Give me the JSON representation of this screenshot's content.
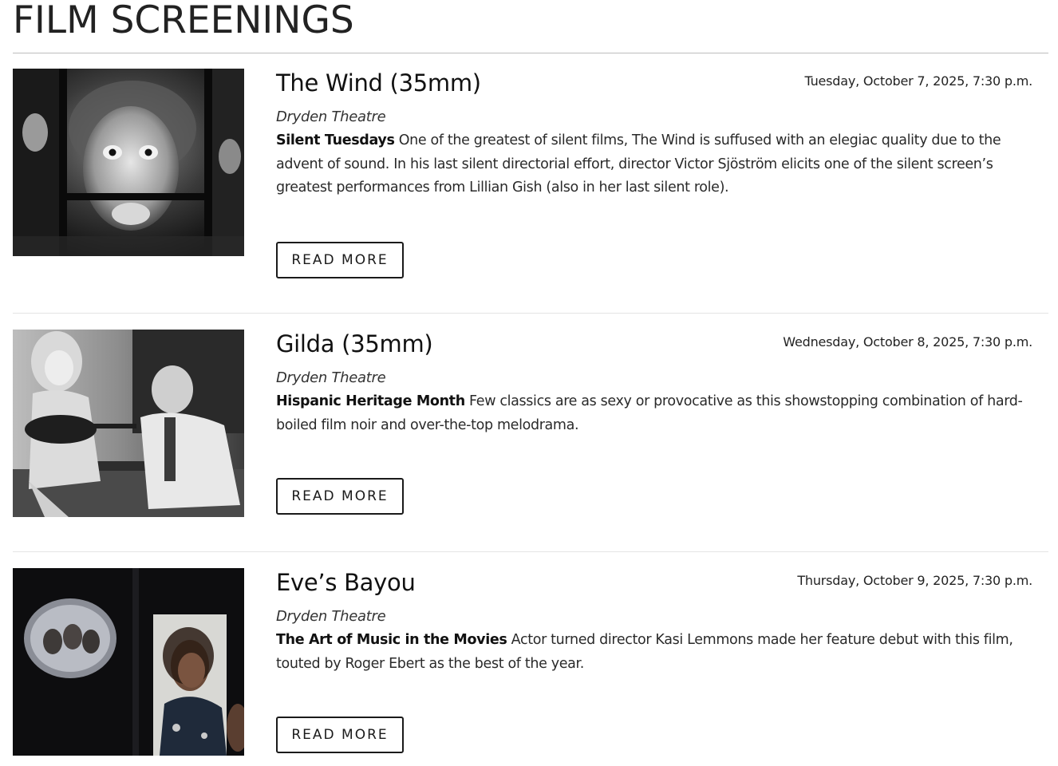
{
  "page": {
    "title": "FILM SCREENINGS"
  },
  "events": [
    {
      "title": "The Wind (35mm)",
      "date": "Tuesday, October 7, 2025, 7:30 p.m.",
      "venue": "Dryden Theatre",
      "series": "Silent Tuesdays",
      "description": "One of the greatest of silent films, The Wind is suffused with an elegiac quality due to the advent of sound. In his last silent directorial effort, director Victor Sjöström elicits one of the silent screen’s greatest performances from Lillian Gish (also in her last silent role).",
      "button": "READ MORE"
    },
    {
      "title": "Gilda (35mm)",
      "date": "Wednesday, October 8, 2025, 7:30 p.m.",
      "venue": "Dryden Theatre",
      "series": "Hispanic Heritage Month",
      "description": "Few classics are as sexy or provocative as this showstopping combination of hard-boiled film noir and over-the-top melodrama.",
      "button": "READ MORE"
    },
    {
      "title": "Eve’s Bayou",
      "date": "Thursday, October 9, 2025, 7:30 p.m.",
      "venue": "Dryden Theatre",
      "series": "The Art of Music in the Movies",
      "description": "Actor turned director Kasi Lemmons made her feature debut with this film, touted by Roger Ebert as the best of the year.",
      "button": "READ MORE"
    }
  ]
}
